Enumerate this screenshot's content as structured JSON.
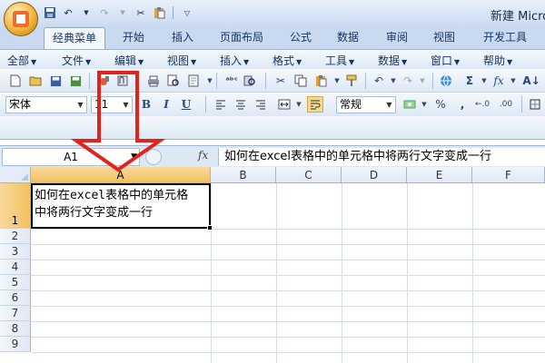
{
  "window": {
    "title": "新建 Micro"
  },
  "ribbon_tabs": [
    "经典菜单",
    "开始",
    "插入",
    "页面布局",
    "公式",
    "数据",
    "审阅",
    "视图",
    "开发工具"
  ],
  "menu_items": [
    "全部",
    "文件",
    "编辑",
    "视图",
    "插入",
    "格式",
    "工具",
    "数据",
    "窗口",
    "帮助"
  ],
  "toolbar": {
    "font_name": "宋体",
    "font_size": "11",
    "bold_label": "B",
    "italic_label": "I",
    "underline_label": "U",
    "number_format": "常规",
    "percent_label": "%",
    "comma_label": ",",
    "sigma_label": "Σ",
    "fx_label": "fx"
  },
  "formula_bar": {
    "name_box": "A1",
    "fx_label": "fx",
    "content": "如何在excel表格中的单元格中将两行文字变成一行"
  },
  "sheet": {
    "columns": [
      "A",
      "B",
      "C",
      "D",
      "E",
      "F"
    ],
    "rows": [
      "1",
      "2",
      "3",
      "4",
      "5",
      "6",
      "7",
      "8",
      "9"
    ],
    "selected_cell": "A1",
    "a1_line1": "如何在excel表格中的单元格",
    "a1_line2": "中将两行文字变成一行"
  },
  "colors": {
    "ribbon_blue": "#c9daf0",
    "selected_header": "#f1c15f",
    "arrow_red": "#e2231a"
  }
}
